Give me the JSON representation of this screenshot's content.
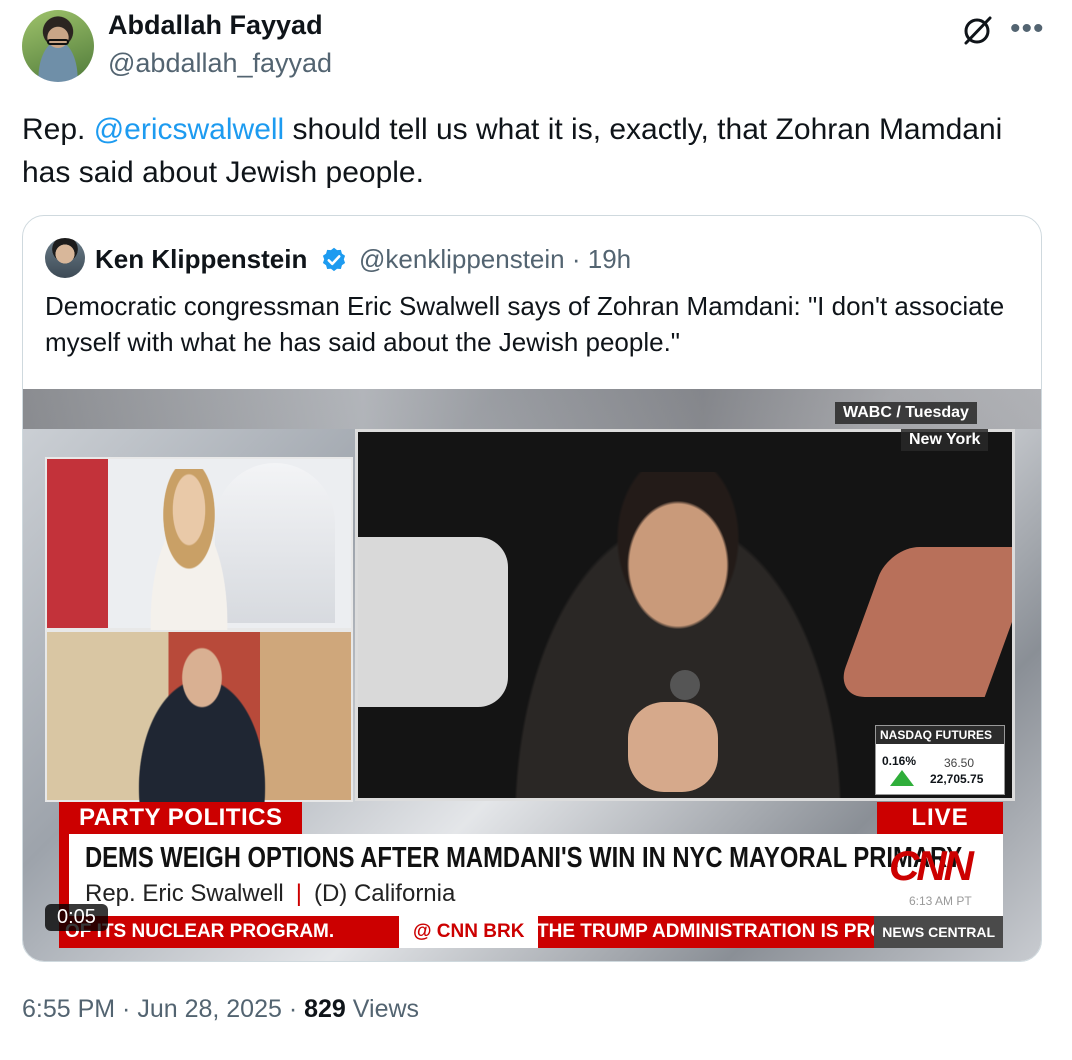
{
  "tweet": {
    "author_name": "Abdallah Fayyad",
    "author_handle": "@abdallah_fayyad",
    "text_before": "Rep. ",
    "mention": "@ericswalwell",
    "text_after": " should tell us what it is, exactly, that Zohran Mamdani has said about Jewish people.",
    "time": "6:55 PM",
    "date": "Jun 28, 2025",
    "views_count": "829",
    "views_label": "Views",
    "sep": " · "
  },
  "quote": {
    "author_name": "Ken Klippenstein",
    "author_handle": "@kenklippenstein · 19h",
    "text": "Democratic congressman Eric Swalwell says of Zohran Mamdani: \"I don't associate myself with what he has said about the Jewish people.\""
  },
  "video": {
    "station_tag": "WABC / Tuesday",
    "city_tag": "New York",
    "ticker_title": "NASDAQ FUTURES",
    "ticker_pct": "0.16%",
    "ticker_change": "36.50",
    "ticker_value": "22,705.75",
    "party_label": "PARTY POLITICS",
    "live_label": "LIVE",
    "headline": "DEMS WEIGH OPTIONS AFTER MAMDANI'S WIN IN NYC MAYORAL PRIMARY",
    "guest_name": "Rep. Eric Swalwell",
    "guest_party": "(D) California",
    "network": "CNN",
    "clock": "6:13 AM PT",
    "crawl_left": "OF ITS NUCLEAR PROGRAM.",
    "crawl_brk": "@ CNN BRK",
    "crawl_right": "THE TRUMP ADMINISTRATION IS PRO",
    "crawl_tag": "NEWS CENTRAL",
    "duration": "0:05"
  },
  "icons": {
    "grok": "grok-icon",
    "more": "more-icon",
    "verified": "verified-icon"
  },
  "colors": {
    "link": "#1d9bf0",
    "cnn_red": "#cc0000",
    "secondary_text": "#536471"
  }
}
